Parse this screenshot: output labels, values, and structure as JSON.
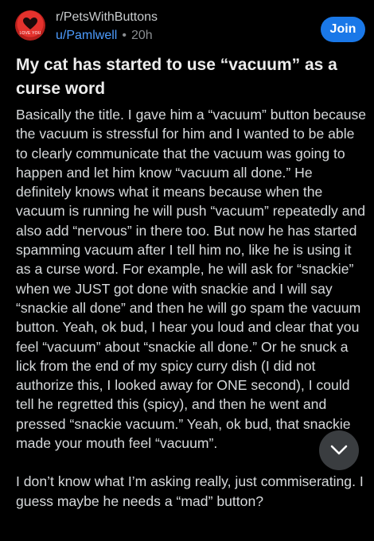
{
  "post": {
    "subreddit": "r/PetsWithButtons",
    "author": "u/Pamlwell",
    "separator": "•",
    "age": "20h",
    "join_label": "Join",
    "avatar_text": "LOVE YOU",
    "title": "My cat has started to use “vacuum” as a curse word",
    "paragraphs": [
      "Basically the title. I gave him a “vacuum” button because the vacuum is stressful for him and I wanted to be able to clearly communicate that the vacuum was going to happen and let him know “vacuum all done.” He definitely knows what it means because when the vacuum is running he will push “vacuum” repeatedly and also add “nervous” in there too. But now he has started spamming vacuum after I tell him no, like he is using it as a curse word. For example, he will ask for “snackie” when we JUST got done with snackie and I will say “snackie all done” and then he will go spam the vacuum button. Yeah, ok bud, I hear you loud and clear that you feel “vacuum” about “snackie all done.” Or he snuck a lick from the end of my spicy curry dish (I did not authorize this, I looked away for ONE second), I could tell he regretted this (spicy), and then he went and pressed “snackie vacuum.” Yeah, ok bud, that snackie made your mouth feel “vacuum”.",
      "I don’t know what I’m asking really, just commiserating. I guess maybe he needs a “mad” button?"
    ]
  },
  "icons": {
    "avatar": "heart-icon",
    "scroll": "chevron-down-icon"
  },
  "colors": {
    "background": "#000000",
    "accent": "#1a78e8",
    "link": "#4d9cff",
    "avatar_red": "#e5322d"
  }
}
